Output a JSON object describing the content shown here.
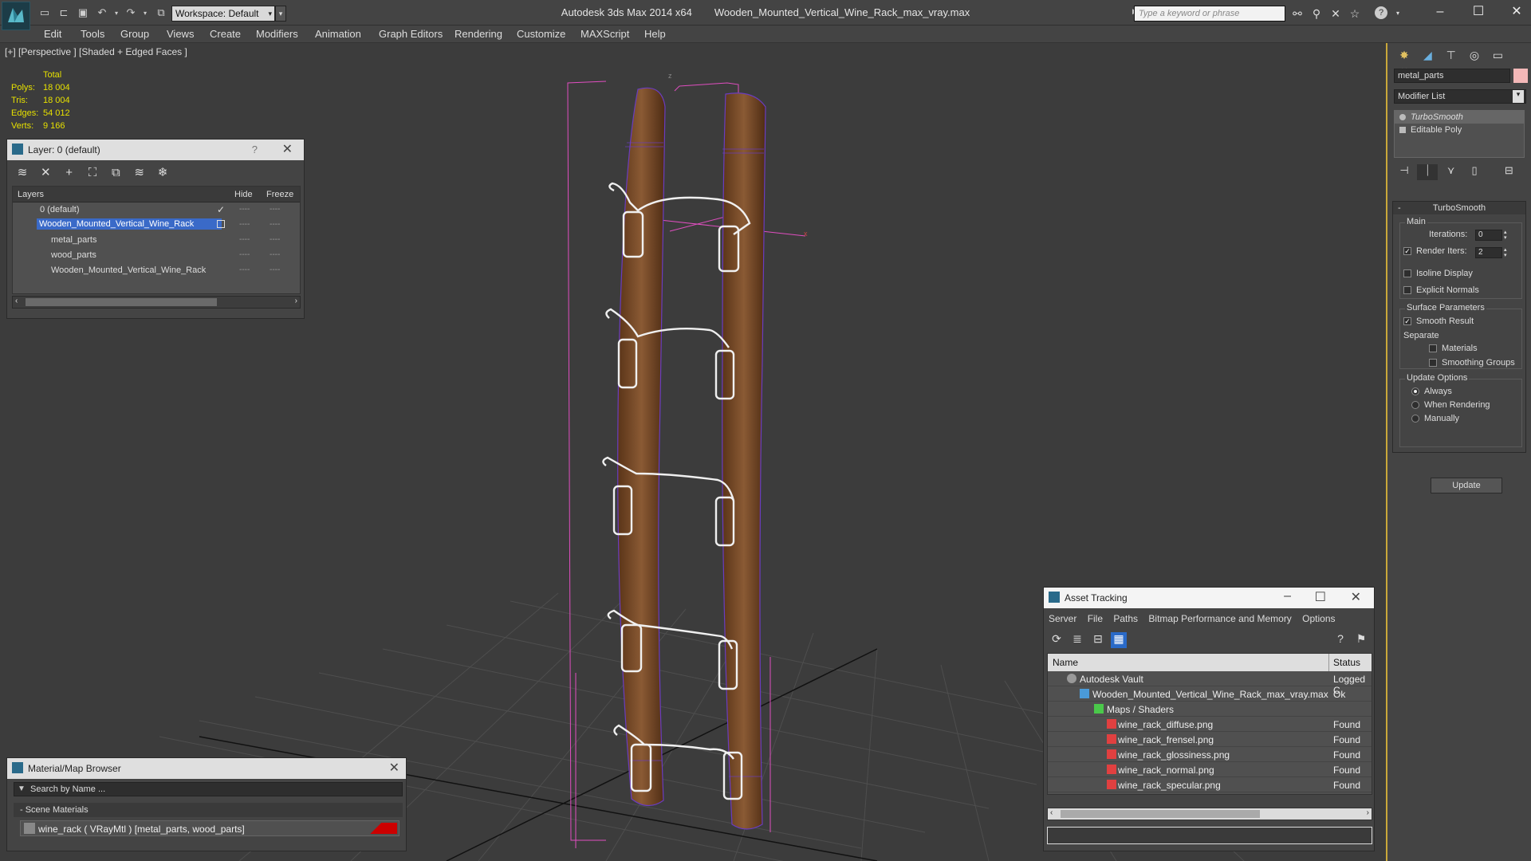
{
  "app": {
    "title": "Autodesk 3ds Max  2014 x64",
    "file": "Wooden_Mounted_Vertical_Wine_Rack_max_vray.max",
    "workspace": "Workspace: Default",
    "search_placeholder": "Type a keyword or phrase",
    "icons": [
      "new-file-icon",
      "open-file-icon",
      "save-icon",
      "undo-icon",
      "redo-icon",
      "project-icon"
    ]
  },
  "menu": [
    "Edit",
    "Tools",
    "Group",
    "Views",
    "Create",
    "Modifiers",
    "Animation",
    "Graph Editors",
    "Rendering",
    "Customize",
    "MAXScript",
    "Help"
  ],
  "viewport": {
    "label": "[+] [Perspective ] [Shaded + Edged Faces ]",
    "stats": {
      "header": "Total",
      "rows": [
        {
          "k": "Polys:",
          "v": "18 004"
        },
        {
          "k": "Tris:",
          "v": "18 004"
        },
        {
          "k": "Edges:",
          "v": "54 012"
        },
        {
          "k": "Verts:",
          "v": "9 166"
        }
      ]
    }
  },
  "layer_panel": {
    "title": "Layer: 0 (default)",
    "help": "?",
    "columns": {
      "layers": "Layers",
      "hide": "Hide",
      "freeze": "Freeze"
    },
    "rows": [
      {
        "name": "0 (default)",
        "selected": false,
        "check": "✓"
      },
      {
        "name": "Wooden_Mounted_Vertical_Wine_Rack",
        "selected": true,
        "check": ""
      },
      {
        "name": "metal_parts",
        "selected": false,
        "check": ""
      },
      {
        "name": "wood_parts",
        "selected": false,
        "check": ""
      },
      {
        "name": "Wooden_Mounted_Vertical_Wine_Rack",
        "selected": false,
        "check": ""
      }
    ],
    "dash": "----"
  },
  "material_browser": {
    "title": "Material/Map Browser",
    "search_placeholder": "Search by Name ...",
    "category": "- Scene Materials",
    "item": "wine_rack  ( VRayMtl )  [metal_parts, wood_parts]",
    "swatch_color": "#cc0000"
  },
  "asset_tracking": {
    "title": "Asset Tracking",
    "menu": [
      "Server",
      "File",
      "Paths",
      "Bitmap Performance and Memory",
      "Options"
    ],
    "columns": {
      "name": "Name",
      "status": "Status"
    },
    "rows": [
      {
        "name": "Autodesk Vault",
        "status": "Logged C",
        "indent": 1,
        "icon": "vault-icon"
      },
      {
        "name": "Wooden_Mounted_Vertical_Wine_Rack_max_vray.max",
        "status": "Ok",
        "indent": 2,
        "icon": "max-file-icon"
      },
      {
        "name": "Maps / Shaders",
        "status": "",
        "indent": 3,
        "icon": "maps-folder-icon"
      },
      {
        "name": "wine_rack_diffuse.png",
        "status": "Found",
        "indent": 4,
        "icon": "png-icon"
      },
      {
        "name": "wine_rack_frensel.png",
        "status": "Found",
        "indent": 4,
        "icon": "png-icon"
      },
      {
        "name": "wine_rack_glossiness.png",
        "status": "Found",
        "indent": 4,
        "icon": "png-icon"
      },
      {
        "name": "wine_rack_normal.png",
        "status": "Found",
        "indent": 4,
        "icon": "png-icon"
      },
      {
        "name": "wine_rack_specular.png",
        "status": "Found",
        "indent": 4,
        "icon": "png-icon"
      }
    ]
  },
  "command_panel": {
    "object_name": "metal_parts",
    "object_color": "#f3b8b8",
    "modifier_list": "Modifier List",
    "stack": [
      "TurboSmooth",
      "Editable Poly"
    ],
    "rollout_title": "TurboSmooth",
    "main": {
      "label": "Main",
      "iterations_label": "Iterations:",
      "iterations": "0",
      "render_iters_label": "Render Iters:",
      "render_iters": "2",
      "render_iters_checked": true,
      "isoline_label": "Isoline Display",
      "explicit_label": "Explicit Normals"
    },
    "surface": {
      "label": "Surface Parameters",
      "smooth_label": "Smooth Result",
      "separate_label": "Separate",
      "materials_label": "Materials",
      "smoothing_label": "Smoothing Groups"
    },
    "update": {
      "label": "Update Options",
      "always": "Always",
      "when_rendering": "When Rendering",
      "manually": "Manually",
      "button": "Update"
    }
  }
}
